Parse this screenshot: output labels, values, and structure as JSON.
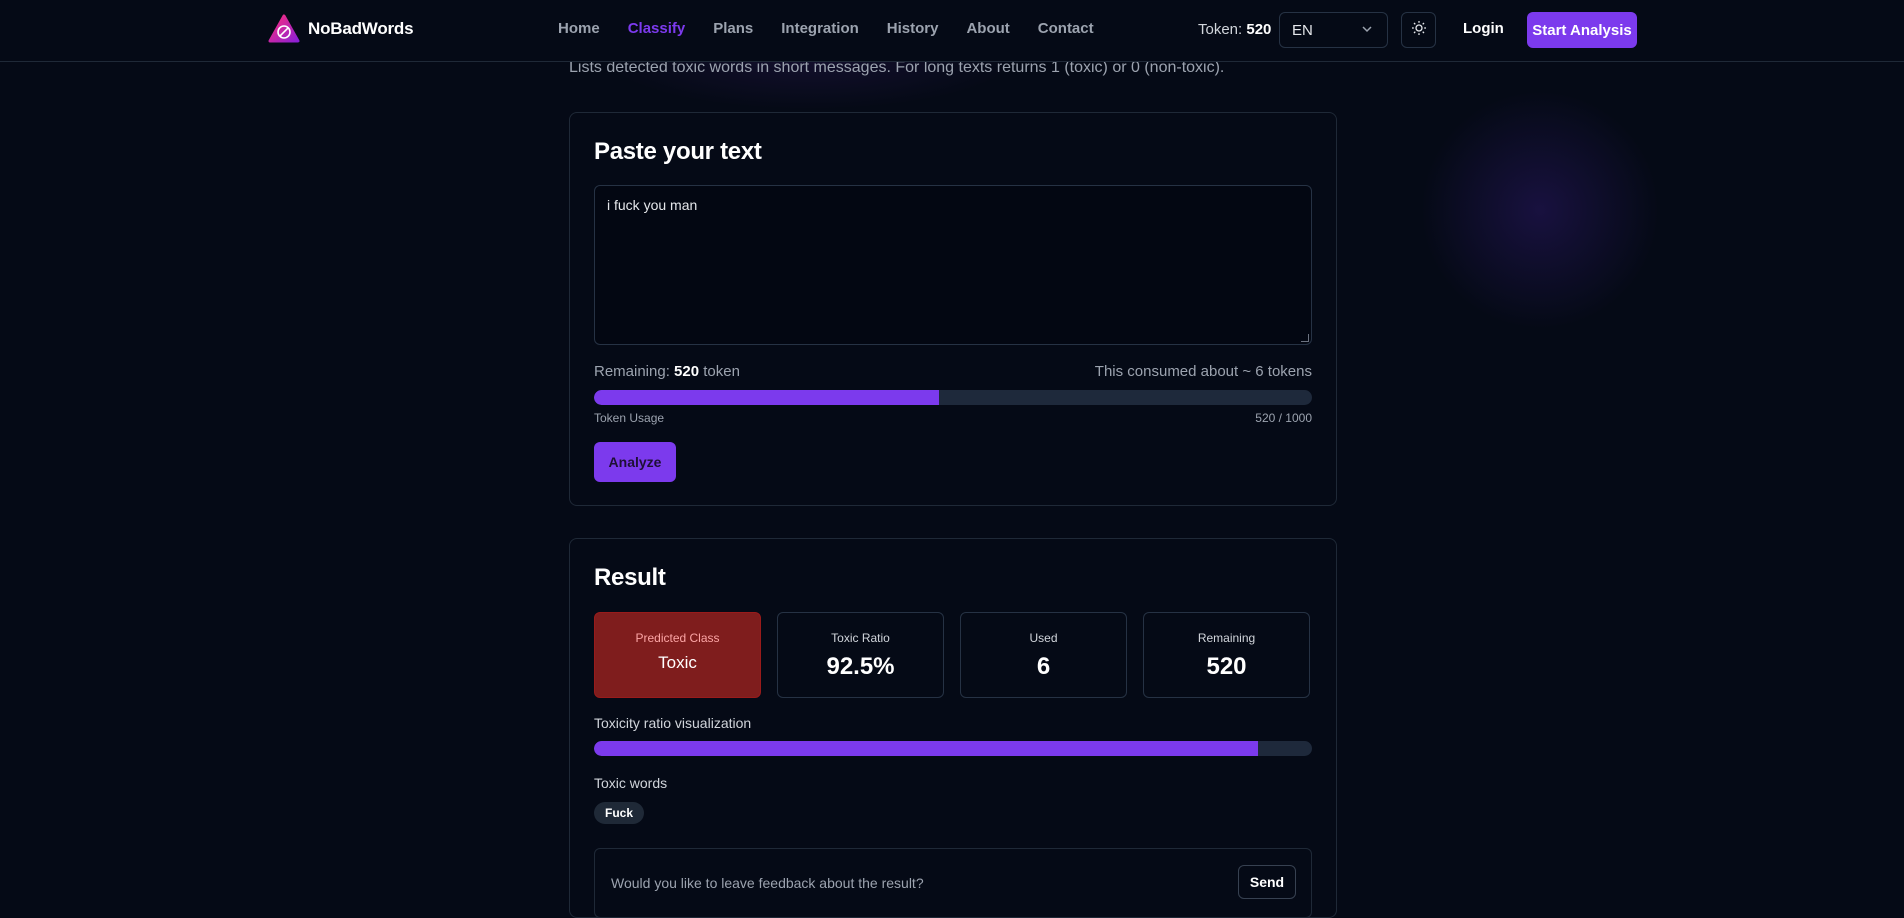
{
  "header": {
    "brand": "NoBadWords",
    "nav": [
      {
        "label": "Home",
        "active": false
      },
      {
        "label": "Classify",
        "active": true
      },
      {
        "label": "Plans",
        "active": false
      },
      {
        "label": "Integration",
        "active": false
      },
      {
        "label": "History",
        "active": false
      },
      {
        "label": "About",
        "active": false
      },
      {
        "label": "Contact",
        "active": false
      }
    ],
    "token_label": "Token:",
    "token_value": "520",
    "language": "EN",
    "login": "Login",
    "start_analysis": "Start Analysis",
    "accent_color": "#7c3aed"
  },
  "subtitle": "Lists detected toxic words in short messages. For long texts returns 1 (toxic) or 0 (non-toxic).",
  "input_card": {
    "title": "Paste your text",
    "text": "i fuck you man",
    "remaining_label": "Remaining:",
    "remaining_value": "520",
    "remaining_unit": "token",
    "consumed": "This consumed about ~ 6 tokens",
    "usage_label": "Token Usage",
    "usage_text": "520 / 1000",
    "usage_fraction": 0.48,
    "analyze": "Analyze"
  },
  "result_card": {
    "title": "Result",
    "stats": [
      {
        "label": "Predicted Class",
        "value": "Toxic"
      },
      {
        "label": "Toxic Ratio",
        "value": "92.5%"
      },
      {
        "label": "Used",
        "value": "6"
      },
      {
        "label": "Remaining",
        "value": "520"
      }
    ],
    "viz_label": "Toxicity ratio visualization",
    "toxic_ratio": 0.925,
    "words_label": "Toxic words",
    "toxic_words": [
      "Fuck"
    ],
    "feedback_placeholder": "Would you like to leave feedback about the result?",
    "send": "Send",
    "toxic_color": "#7f1d1d"
  }
}
